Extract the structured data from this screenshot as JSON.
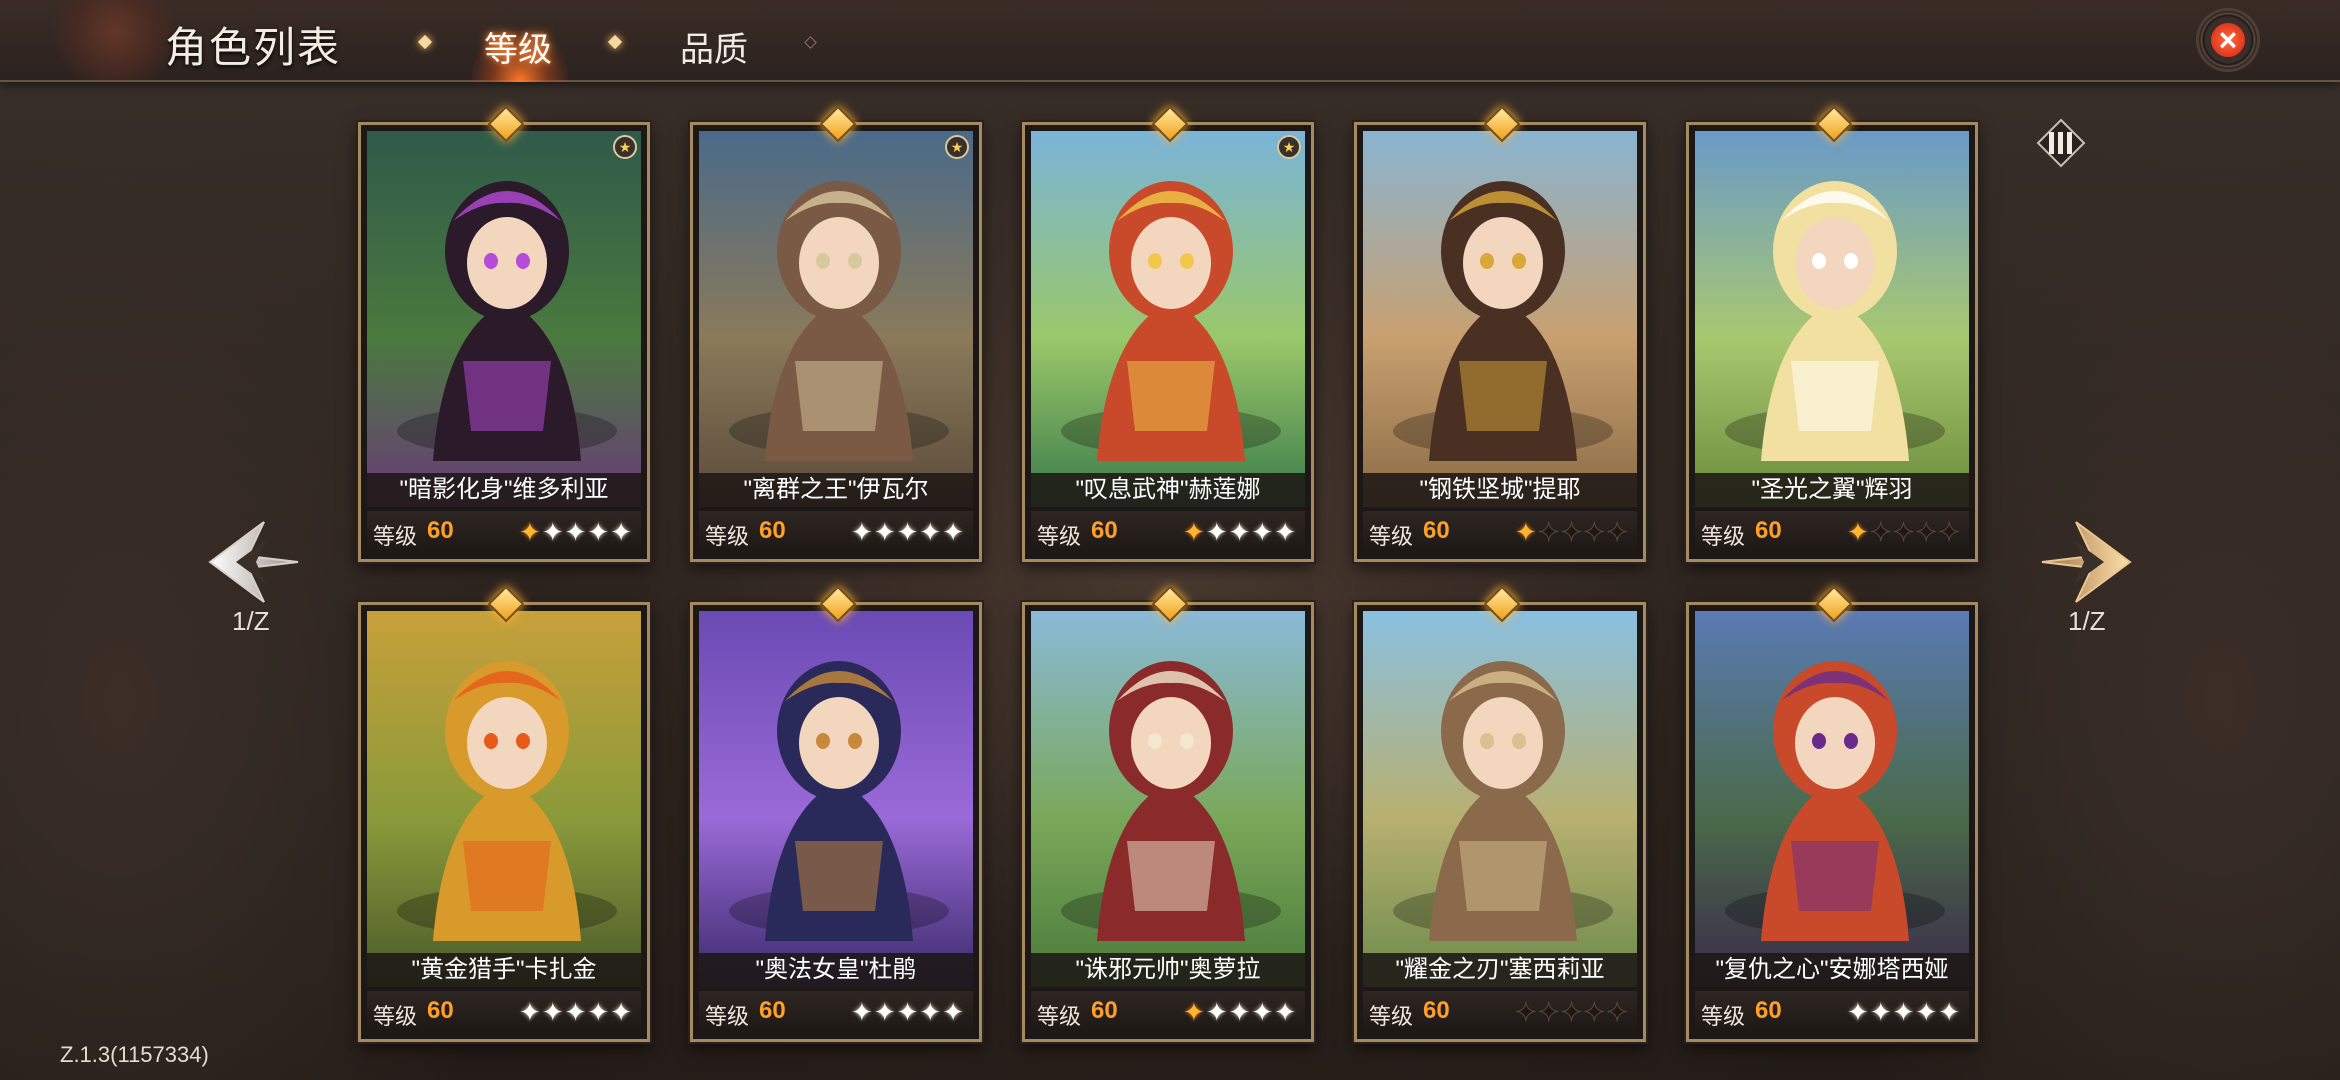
{
  "header": {
    "title": "角色列表",
    "tabs": [
      {
        "label": "等级",
        "active": true
      },
      {
        "label": "品质",
        "active": false
      }
    ],
    "close_icon": "close-icon"
  },
  "pagination": {
    "left_indicator": "1/Z",
    "right_indicator": "1/Z"
  },
  "version": "Z.1.3(1157334)",
  "level_label": "等级",
  "colors": {
    "accent_orange": "#ff9f2a",
    "frame_gold": "#a58a5f",
    "close_red": "#e2381e"
  },
  "cards": [
    {
      "name": "\"暗影化身\"维多利亚",
      "level": "60",
      "stars": "gbbbb",
      "fav": true,
      "theme": [
        "#2f5a4a",
        "#4a7a3e",
        "#6a3a7a"
      ],
      "figure": "#2a1a2a",
      "accent": "#b74ad8"
    },
    {
      "name": "\"离群之王\"伊瓦尔",
      "level": "60",
      "stars": "bbbbb",
      "fav": true,
      "theme": [
        "#4a6a8a",
        "#8a7a5a",
        "#5a4a3a"
      ],
      "figure": "#7a5a44",
      "accent": "#d8c8a0"
    },
    {
      "name": "\"叹息武神\"赫莲娜",
      "level": "60",
      "stars": "gbbbb",
      "fav": true,
      "theme": [
        "#7ab4d8",
        "#9ac86a",
        "#3a7a4a"
      ],
      "figure": "#c84a2a",
      "accent": "#f2c84a"
    },
    {
      "name": "\"钢铁坚城\"提耶",
      "level": "60",
      "stars": "gdddd",
      "fav": false,
      "theme": [
        "#8ab4d0",
        "#c8a070",
        "#8a6a44"
      ],
      "figure": "#4a3022",
      "accent": "#d8a83a"
    },
    {
      "name": "\"圣光之翼\"辉羽",
      "level": "60",
      "stars": "gdddd",
      "fav": false,
      "theme": [
        "#6a9ac8",
        "#a8c870",
        "#6a8a3a"
      ],
      "figure": "#f2e0a0",
      "accent": "#ffffff"
    },
    {
      "name": "\"黄金猎手\"卡扎金",
      "level": "60",
      "stars": "bbbbb",
      "fav": false,
      "theme": [
        "#c8a03a",
        "#8a9a3a",
        "#4a5a2a"
      ],
      "figure": "#d89a2a",
      "accent": "#e85a1a"
    },
    {
      "name": "\"奥法女皇\"杜鹃",
      "level": "60",
      "stars": "bbbbb",
      "fav": false,
      "theme": [
        "#6a4ab4",
        "#9a6ad8",
        "#3a2a6a"
      ],
      "figure": "#2a2a5a",
      "accent": "#c88a3a"
    },
    {
      "name": "\"诛邪元帅\"奥萝拉",
      "level": "60",
      "stars": "gbbbb",
      "fav": false,
      "theme": [
        "#8abad8",
        "#7aa85a",
        "#4a7a3a"
      ],
      "figure": "#8a2a2a",
      "accent": "#f2e8d0"
    },
    {
      "name": "\"耀金之刃\"塞西莉亚",
      "level": "60",
      "stars": "dddd",
      "fav": false,
      "theme": [
        "#8ac0e0",
        "#b8b070",
        "#6a8a4a"
      ],
      "figure": "#8a6a4a",
      "accent": "#d8c090"
    },
    {
      "name": "\"复仇之心\"安娜塔西娅",
      "level": "60",
      "stars": "bbbbb",
      "fav": false,
      "theme": [
        "#5a7ab4",
        "#4a6a4a",
        "#3a2a4a"
      ],
      "figure": "#c84a2a",
      "accent": "#6a2a8a"
    }
  ]
}
